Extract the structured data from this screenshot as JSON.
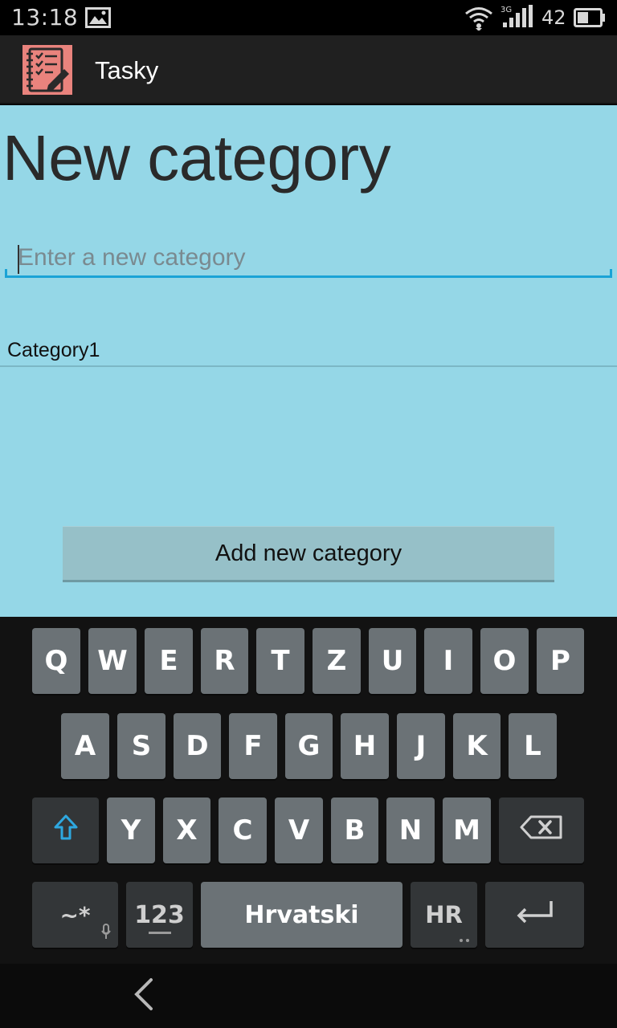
{
  "status_bar": {
    "time": "13:18",
    "network": "3G",
    "battery": "42",
    "icons": [
      "image-icon",
      "wifi-icon",
      "signal-icon",
      "battery-icon"
    ]
  },
  "action_bar": {
    "app_title": "Tasky",
    "icon": "notebook-checklist-icon"
  },
  "main": {
    "title": "New category",
    "input": {
      "value": "",
      "placeholder": "Enter a new category"
    },
    "categories": [
      "Category1"
    ],
    "add_button_label": "Add new category"
  },
  "keyboard": {
    "row1": [
      "Q",
      "W",
      "E",
      "R",
      "T",
      "Z",
      "U",
      "I",
      "O",
      "P"
    ],
    "row2": [
      "A",
      "S",
      "D",
      "F",
      "G",
      "H",
      "J",
      "K",
      "L"
    ],
    "row3": [
      "Y",
      "X",
      "C",
      "V",
      "B",
      "N",
      "M"
    ],
    "symbols_label": "~*",
    "numbers_label": "123",
    "space_label": "Hrvatski",
    "language_label": "HR",
    "icons": [
      "shift-icon",
      "backspace-icon",
      "enter-icon",
      "microphone-icon"
    ]
  },
  "nav_bar": {
    "icons": [
      "back-icon"
    ]
  },
  "colors": {
    "content_bg": "#95d7e7",
    "accent": "#1aa3d6",
    "action_bar": "#202020",
    "key_bg": "#6b7276",
    "key_dark": "#333638"
  }
}
